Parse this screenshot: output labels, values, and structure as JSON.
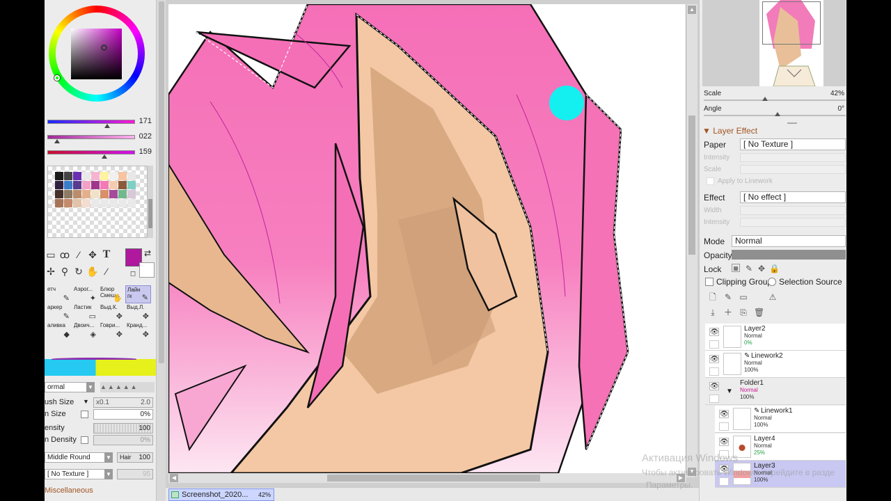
{
  "color": {
    "slider_1": "171",
    "slider_2": "022",
    "slider_3": "159",
    "main_color": "#b0189e",
    "sub_color": "#ffffff"
  },
  "swatches": [
    "#1a1a1a",
    "#444444",
    "#6b2fb1",
    "#e9e9e9",
    "#f6b4d0",
    "#fff2a0",
    "#f0f0f0",
    "#f7c3a1",
    "#e8e8e8",
    "#302040",
    "#3b7bc9",
    "#583a8f",
    "#f2a1c5",
    "#a1358c",
    "#f27ab5",
    "#f4cdb0",
    "#8c5a3c",
    "#7fd0c4",
    "#46302a",
    "#8d7a64",
    "#bb8c6a",
    "#e4b08c",
    "#f0e2c8",
    "#d99068",
    "#a64a9a",
    "#6fb98c",
    "#d8c8d8",
    "#a87458",
    "#c48b6c",
    "#e2c2a8",
    "#f2ddd0",
    "#e9e9e9",
    "#e9e9e9",
    "#e9e9e9",
    "#e9e9e9",
    "#e9e9e9"
  ],
  "tools": {
    "text_tool": "T",
    "brushes": [
      {
        "label": "етч",
        "label2": ""
      },
      {
        "label": "Аэрог...",
        "label2": ""
      },
      {
        "label": "Блюр",
        "label2": "Смеш..."
      },
      {
        "label": "Лайн",
        "label2": "гк"
      },
      {
        "label": "аркер",
        "label2": ""
      },
      {
        "label": "Ластик",
        "label2": ""
      },
      {
        "label": "Выд.К.",
        "label2": ""
      },
      {
        "label": "Выд.Л.",
        "label2": ""
      },
      {
        "label": "аливка",
        "label2": ""
      },
      {
        "label": "Двоич...",
        "label2": ""
      },
      {
        "label": "Говри...",
        "label2": ""
      },
      {
        "label": "Кранд...",
        "label2": ""
      }
    ]
  },
  "brush_props": {
    "blend_mode": "ormal",
    "brush_size_label": "ush Size",
    "brush_size_mult": "x0.1",
    "brush_size_value": "2.0",
    "min_size_label": "n Size",
    "min_size_value": "0%",
    "density_label": "ensity",
    "density_value": "100",
    "min_density_label": "n Density",
    "min_density_value": "0%",
    "shape": "Middle Round",
    "shape_label": "Hair",
    "shape_value": "100",
    "texture": "[ No Texture ]",
    "texture_value": "95",
    "misc": "Miscellaneous"
  },
  "navigator": {
    "scale_label": "Scale",
    "scale_value": "42%",
    "angle_label": "Angle",
    "angle_value": "0°"
  },
  "layer_effect": {
    "header": "Layer Effect",
    "paper_label": "Paper",
    "paper_value": "[ No Texture ]",
    "intensity_label": "Intensity",
    "scale_label": "Scale",
    "apply_linework": "Apply to Linework",
    "effect_label": "Effect",
    "effect_value": "[ No effect ]",
    "width_label": "Width",
    "intensity2_label": "Intensity"
  },
  "layer_props": {
    "mode_label": "Mode",
    "mode_value": "Normal",
    "opacity_label": "Opacity",
    "lock_label": "Lock",
    "clipping_group": "Clipping Group",
    "selection_source": "Selection Source"
  },
  "layers": [
    {
      "name": "Layer2",
      "mode": "Normal",
      "opacity": "0%",
      "type": "layer",
      "opacity_color": "green"
    },
    {
      "name": "Linework2",
      "mode": "Normal",
      "opacity": "100%",
      "type": "linework"
    },
    {
      "name": "Folder1",
      "mode": "Normal",
      "opacity": "100%",
      "type": "folder"
    },
    {
      "name": "Linework1",
      "mode": "Normal",
      "opacity": "100%",
      "type": "linework-child"
    },
    {
      "name": "Layer4",
      "mode": "Normal",
      "opacity": "25%",
      "type": "child",
      "opacity_color": "green"
    },
    {
      "name": "Layer3",
      "mode": "Normal",
      "opacity": "100%",
      "type": "child-selected"
    }
  ],
  "document": {
    "tab_label": "Screenshot_2020...",
    "zoom": "42%"
  },
  "watermark": {
    "line1": "Активация Windows",
    "line2": "Чтобы активировать Windows, перейдите в разде",
    "line3": "Параметры."
  }
}
